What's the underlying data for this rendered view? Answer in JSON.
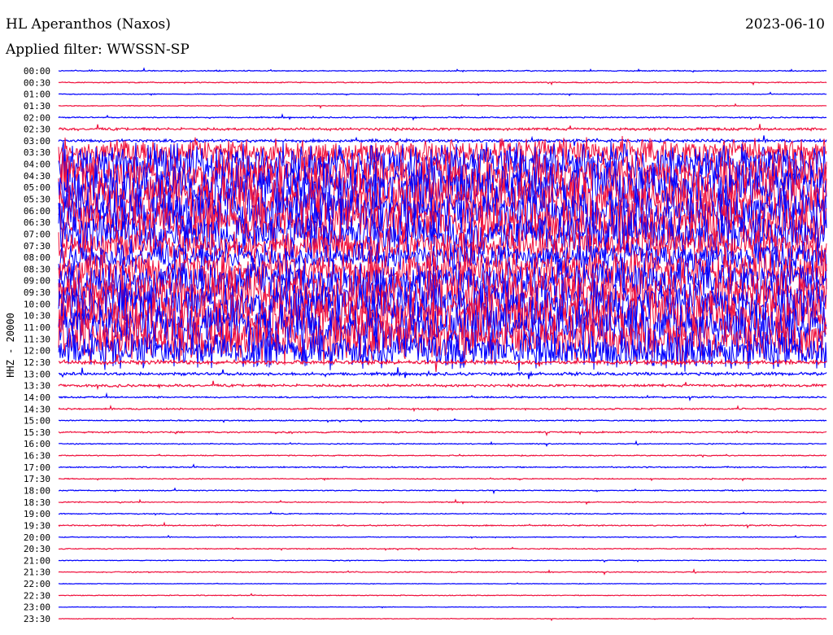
{
  "header": {
    "station": "HL Aperanthos (Naxos)",
    "date": "2023-06-10",
    "filter": "Applied filter: WWSSN-SP"
  },
  "chart_data": {
    "type": "line",
    "title": "HL Aperanthos (Naxos)",
    "ylabel": "HHZ - 20000",
    "colors": {
      "hour": "#0000ff",
      "half_hour": "#f0103c"
    },
    "rows": [
      "00:00",
      "00:30",
      "01:00",
      "01:30",
      "02:00",
      "02:30",
      "03:00",
      "03:30",
      "04:00",
      "04:30",
      "05:00",
      "05:30",
      "06:00",
      "06:30",
      "07:00",
      "07:30",
      "08:00",
      "08:30",
      "09:00",
      "09:30",
      "10:00",
      "10:30",
      "11:00",
      "11:30",
      "12:00",
      "12:30",
      "13:00",
      "13:30",
      "14:00",
      "14:30",
      "15:00",
      "15:30",
      "16:00",
      "16:30",
      "17:00",
      "17:30",
      "18:00",
      "18:30",
      "19:00",
      "19:30",
      "20:00",
      "20:30",
      "21:00",
      "21:30",
      "22:00",
      "22:30",
      "23:00",
      "23:30"
    ],
    "activity_level": [
      0.1,
      0.1,
      0.08,
      0.08,
      0.12,
      0.25,
      0.3,
      0.6,
      0.9,
      1,
      1,
      1,
      1,
      1,
      0.9,
      0.7,
      0.6,
      0.8,
      0.9,
      1,
      1,
      1,
      1,
      1,
      0.8,
      0.4,
      0.3,
      0.25,
      0.15,
      0.15,
      0.12,
      0.15,
      0.1,
      0.1,
      0.12,
      0.1,
      0.1,
      0.1,
      0.1,
      0.12,
      0.08,
      0.1,
      0.08,
      0.1,
      0.06,
      0.08,
      0.06,
      0.06
    ]
  }
}
